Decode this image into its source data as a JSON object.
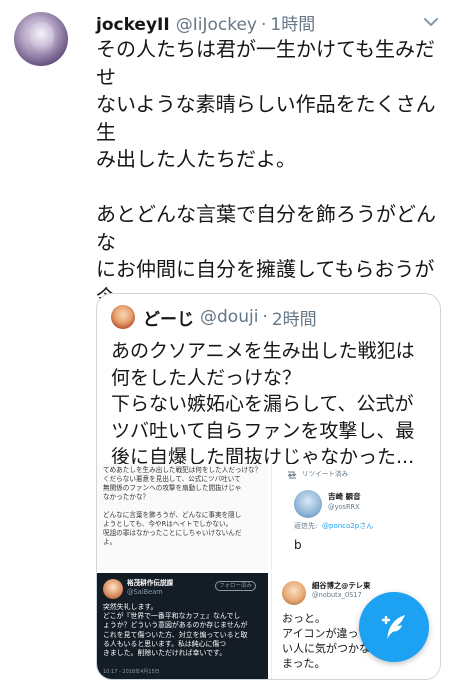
{
  "tweet": {
    "name": "jockeyII",
    "handle": "@IiJockey",
    "separator": "·",
    "time": "1時間",
    "paragraph1": "その人たちは君が一生かけても生みだせ\nないような素晴らしい作品をたくさん生\nみ出した人たちだよ。",
    "paragraph2": "あとどんな言葉で自分を飾ろうがどんな\nにお仲間に自分を擁護してもらおうが今\nのままだと先輩は間違いなく人として失\n敗作確実だしエア友達とカードゲーム大\n会してた事実はなかったことにならない\nよ"
  },
  "quote": {
    "name": "どーじ",
    "handle": "@douji",
    "separator": "·",
    "time": "2時間",
    "text": "あのクソアニメを生み出した戦犯は\n何をした人だっけな？\n下らない嫉妬心を漏らして、公式が\nツバ吐いて自らファンを攻撃し、最\n後に自爆した間抜けじゃなかった..."
  },
  "media": {
    "img1_text": "てめあたしを生み出した戦犯は何をした人だっけな？\nくだらない悪意を見出して、公式にツバ吐いて\n無関係のファンへの攻撃を扇動した間抜けじゃ\nなかったかな？\n\nどんなに言葉を飾ろうが、どんなに事実を隠し\nようとしても、今やRはヘイトでしかない。\n呪詛の罪はなかったことにしちゃいけないんだ\nよ。",
    "img2_retweet": "リツイート済み",
    "img2_name": "吉崎 観音",
    "img2_handle": "@yosRRX",
    "img2_reply_prefix": "返信先:",
    "img2_reply_to": "@ponco2pさん",
    "img2_body": "b",
    "img3_name": "裕茂耕作伝説課",
    "img3_handle": "@SaiBeam",
    "img3_follow": "フォロー済み",
    "img3_text": "突然失礼します。\nどこが『世界で一番平和なカフェ』なんでし\nょうか？どういう意図があるのか存じませんが\nこれを見て傷ついた方、対立を煽っていると取\nる人もいると思います。私は純心に傷つ\nきました。削除いただければ幸いです。",
    "img3_time": "10:17 - 2018年4月15日",
    "img4_name": "細谷博之@テレ東",
    "img4_handle": "@nobutx_0S17",
    "img4_text": "おっと。\nアイコンが違ってた\nい人に気がつかなく\nまった。"
  },
  "icons": {
    "chevron": "chevron-down-icon",
    "compose": "compose-tweet-icon"
  },
  "colors": {
    "accent": "#1da1f2",
    "secondary_text": "#657786",
    "border": "#ccd6dd"
  }
}
